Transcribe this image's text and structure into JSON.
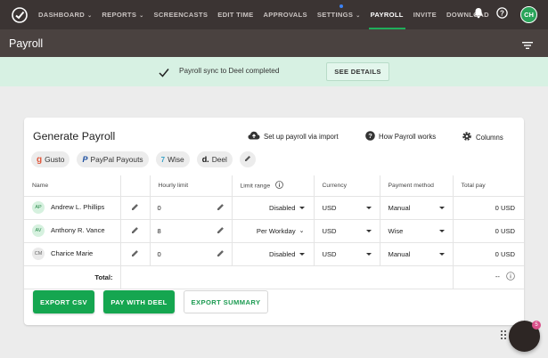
{
  "nav": {
    "items": [
      {
        "label": "DASHBOARD",
        "chevron": true
      },
      {
        "label": "REPORTS",
        "chevron": true
      },
      {
        "label": "SCREENCASTS",
        "chevron": false
      },
      {
        "label": "EDIT TIME",
        "chevron": false
      },
      {
        "label": "APPROVALS",
        "chevron": false
      },
      {
        "label": "SETTINGS",
        "chevron": true
      },
      {
        "label": "PAYROLL",
        "chevron": false
      },
      {
        "label": "INVITE",
        "chevron": false
      },
      {
        "label": "DOWNLOAD",
        "chevron": false
      }
    ],
    "active": "PAYROLL",
    "avatar": "CH"
  },
  "subheader": {
    "title": "Payroll"
  },
  "banner": {
    "message": "Payroll sync to Deel completed",
    "details_label": "SEE DETAILS"
  },
  "card": {
    "title": "Generate Payroll",
    "actions": {
      "import": "Set up payroll via import",
      "how": "How Payroll works",
      "columns": "Columns"
    },
    "chips": [
      "Gusto",
      "PayPal Payouts",
      "Wise",
      "Deel"
    ],
    "columns": [
      "Name",
      "Hourly limit",
      "Limit range",
      "Currency",
      "Payment method",
      "Total pay"
    ],
    "rows": [
      {
        "initials": "AP",
        "name": "Andrew L. Phillips",
        "limit": "0",
        "range": "Disabled",
        "currency": "USD",
        "method": "Manual",
        "total": "0 USD",
        "style": "g"
      },
      {
        "initials": "AV",
        "name": "Anthony R. Vance",
        "limit": "8",
        "range": "Per Workday",
        "currency": "USD",
        "method": "Wise",
        "total": "0 USD",
        "style": "g"
      },
      {
        "initials": "CM",
        "name": "Charice Marie",
        "limit": "0",
        "range": "Disabled",
        "currency": "USD",
        "method": "Manual",
        "total": "0 USD",
        "style": "r"
      }
    ],
    "total_label": "Total:",
    "total_value": "--",
    "buttons": {
      "export_csv": "EXPORT CSV",
      "pay_deel": "PAY WITH DEEL",
      "export_summary": "EXPORT SUMMARY"
    }
  },
  "fab": {
    "badge": "5"
  },
  "colors": {
    "accent": "#15a650",
    "nav_bg": "#3b3433",
    "banner_bg": "#d7f1e3"
  }
}
